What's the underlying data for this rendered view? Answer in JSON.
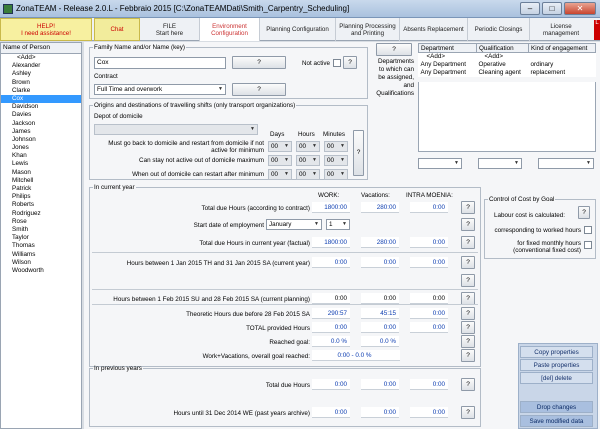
{
  "window": {
    "title": "ZonaTEAM - Release 2.0.L - Febbraio 2015 [C:\\ZonaTEAMDati\\Smith_Carpentry_Scheduling]",
    "min_label": "–",
    "max_label": "□",
    "close_label": "✕"
  },
  "tabs": [
    {
      "line1": "HELP!",
      "line2": "I need assistance!"
    },
    {
      "line1": "Chat",
      "line2": ""
    },
    {
      "line1": "FILE",
      "line2": "Start here"
    },
    {
      "line1": "Environment",
      "line2": "Configuration"
    },
    {
      "line1": "Planning Configuration",
      "line2": ""
    },
    {
      "line1": "Planning Processing",
      "line2": "and Printing"
    },
    {
      "line1": "Absents Replacement",
      "line2": ""
    },
    {
      "line1": "Periodic Closings",
      "line2": ""
    },
    {
      "line1": "License",
      "line2": "management"
    }
  ],
  "flag": "L",
  "people": {
    "header": "Name of Person",
    "items": [
      "<Add>",
      "Alexander",
      "Ashley",
      "Brown",
      "Clarke",
      "Cox",
      "Davidson",
      "Davies",
      "Jackson",
      "James",
      "Johnson",
      "Jones",
      "Khan",
      "Lewis",
      "Mason",
      "Mitchell",
      "Patrick",
      "Philips",
      "Roberts",
      "Rodriguez",
      "Rose",
      "Smith",
      "Taylor",
      "Thomas",
      "Williams",
      "Wilson",
      "Woodworth"
    ],
    "selected": "Cox"
  },
  "family": {
    "legend": "Family Name and/or Name (key)",
    "name_value": "Cox",
    "not_active": "Not active",
    "contract_label": "Contract",
    "contract_value": "Full Time and overwork",
    "q": "?"
  },
  "departments": {
    "label": "Departments to which can be assigned, and Qualifications",
    "headers": [
      "Department",
      "Qualification",
      "Kind of engagement"
    ],
    "rows": [
      [
        "<Add>",
        "<Add>",
        ""
      ],
      [
        "Any Department",
        "Operative",
        "ordinary"
      ],
      [
        "Any Department",
        "Cleaning agent",
        "replacement"
      ]
    ]
  },
  "travel": {
    "legend": "Origins and destinations of travelling shifts (only transport organizations)",
    "depot": "Depot of domicile",
    "col_days": "Days",
    "col_hours": "Hours",
    "col_minutes": "Minutes",
    "row1": "Must go back to domicile and restart from domicile if not active for minimum",
    "row2": "Can stay not active out of domicile maximum",
    "row3": "When out of domicile can restart after minimum",
    "zero": "00"
  },
  "current": {
    "legend": "In current year",
    "h_work": "WORK:",
    "h_vac": "Vacations:",
    "h_intra": "INTRA MOENIA:",
    "total_due": "Total due Hours (according to contract)",
    "total_due_vals": [
      "1800:00",
      "280:00",
      "0:00"
    ],
    "start_emp": "Start date of employment",
    "start_month": "January",
    "start_day": "1",
    "total_factual": "Total due Hours in current year (factual)",
    "total_factual_vals": [
      "1800:00",
      "280:00",
      "0:00"
    ],
    "between1": "Hours between 1 Jan 2015 TH and 31 Jan 2015 SA (current year)",
    "between1_vals": [
      "0:00",
      "0:00",
      "0:00"
    ],
    "between2": "Hours between 1 Feb 2015 SU and 28 Feb 2015 SA (current planning)",
    "between2_vals": [
      "0:00",
      "0:00",
      "0:00"
    ],
    "theoretic": "Theoretic Hours due before 28 Feb 2015 SA",
    "theoretic_vals": [
      "290:57",
      "45:15",
      "0:00"
    ],
    "provided": "TOTAL provided Hours",
    "provided_vals": [
      "0:00",
      "0:00",
      "0:00"
    ],
    "goal": "Reached goal:",
    "goal_vals": [
      "0.0 %",
      "0.0 %"
    ],
    "overall": "Work+Vacations, overall goal reached:",
    "overall_val": "0:00 - 0.0 %"
  },
  "cost": {
    "legend": "Control of Cost by Goal",
    "calculated": "Labour cost is calculated:",
    "worked": "corresponding to worked hours",
    "fixed": "for fixed monthly hours (conventional fixed cost)"
  },
  "previous": {
    "legend": "In previous years",
    "total_due": "Total due Hours",
    "total_due_vals": [
      "0:00",
      "0:00",
      "0:00"
    ],
    "until": "Hours until 31 Dec 2014 WE (past years archive)",
    "until_vals": [
      "0:00",
      "0:00",
      "0:00"
    ]
  },
  "actions": {
    "copy": "Copy properties",
    "paste": "Paste properties",
    "delete": "[del] delete",
    "drop": "Drop changes",
    "save": "Save modified data"
  }
}
